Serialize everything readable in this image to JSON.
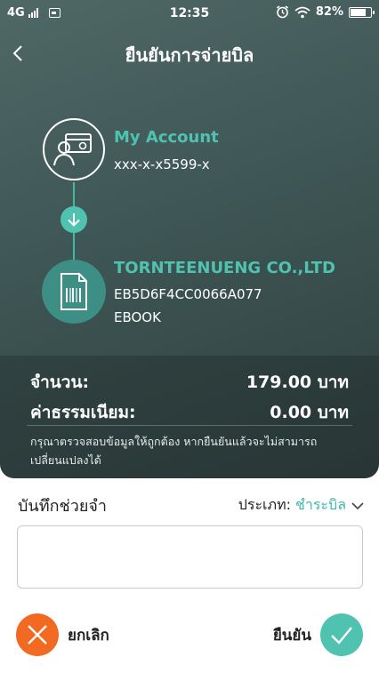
{
  "status_bar": {
    "network": "4G",
    "time": "12:35",
    "battery": "82%",
    "battery_level": 0.82
  },
  "header": {
    "title": "ยืนยันการจ่ายบิล"
  },
  "from": {
    "name": "My Account",
    "number": "xxx-x-x5599-x",
    "icon": "account-card-icon"
  },
  "to": {
    "name": "TORNTEENUENG CO.,LTD",
    "ref1": "EB5D6F4CC0066A077",
    "ref2": "EBOOK",
    "icon": "bill-icon"
  },
  "summary": {
    "amount_label": "จำนวน:",
    "amount_value": "179.00 บาท",
    "fee_label": "ค่าธรรมเนียม:",
    "fee_value": "0.00 บาท",
    "note": "กรุณาตรวจสอบข้อมูลให้ถูกต้อง หากยืนยันแล้วจะไม่สามารถเปลี่ยนแปลงได้"
  },
  "memo": {
    "label": "บันทึกช่วยจำ",
    "type_label": "ประเภท:",
    "type_value": "ชำระบิล",
    "value": ""
  },
  "actions": {
    "cancel_label": "ยกเลิก",
    "confirm_label": "ยืนยัน"
  },
  "colors": {
    "accent": "#4fc3b0",
    "cancel": "#f26a22",
    "header_bg": "#3e5655"
  }
}
